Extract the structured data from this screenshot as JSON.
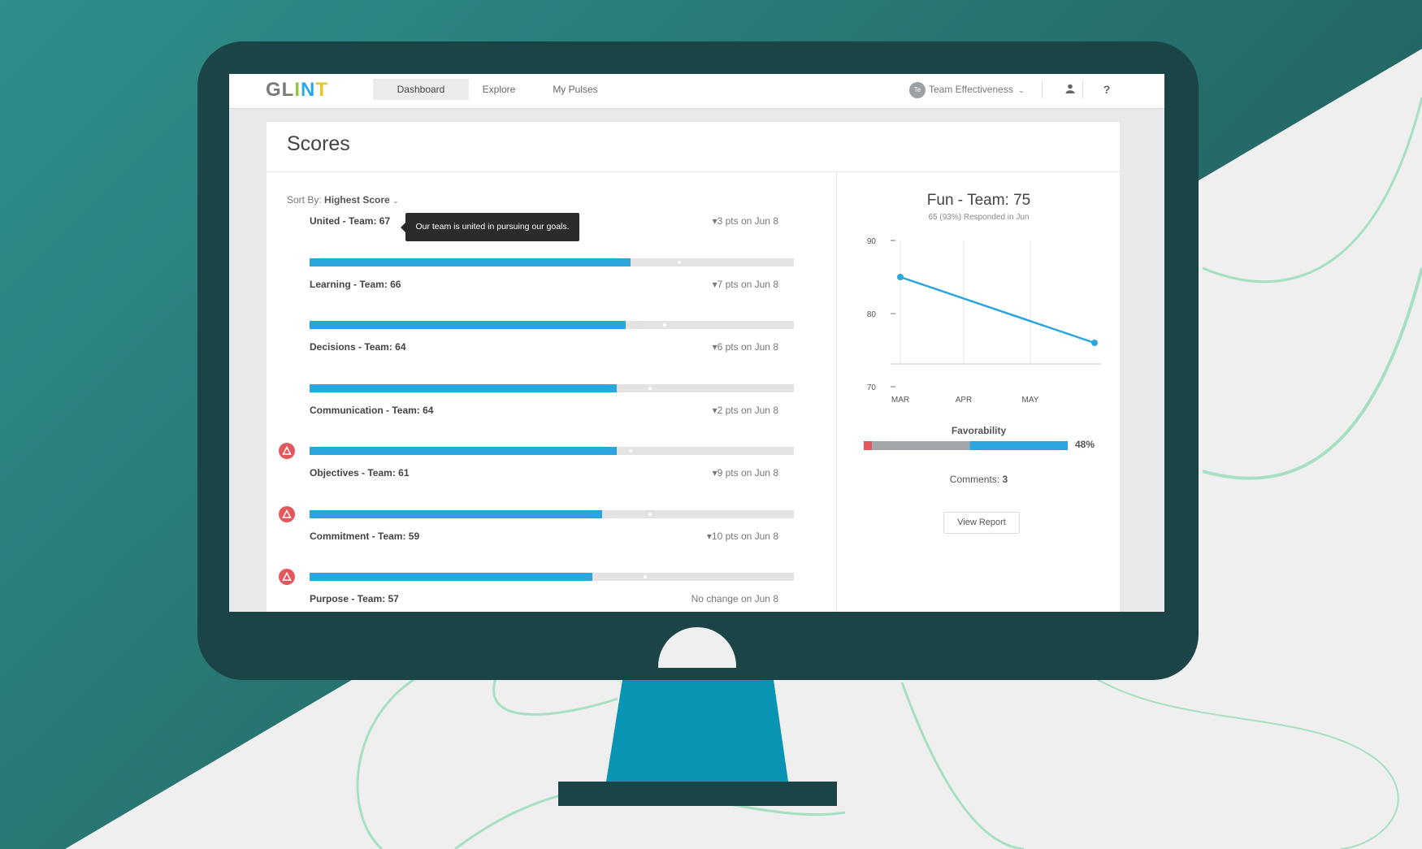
{
  "colors": {
    "bg_teal": "#2e8a86",
    "monitor": "#1b4447",
    "stand": "#0a94b4",
    "accent_blue": "#2aa6dd",
    "alert_red": "#e4585d"
  },
  "app": {
    "logo": [
      "GL",
      "I",
      "N",
      "T"
    ],
    "nav": [
      {
        "label": "Dashboard",
        "active": true
      },
      {
        "label": "Explore"
      },
      {
        "label": "My Pulses"
      }
    ],
    "team_badge": "Te",
    "team_selector": "Team Effectiveness",
    "user_icon": "user-icon",
    "help_label": "?"
  },
  "scores": {
    "title": "Scores",
    "sort_prefix": "Sort By:",
    "sort_value": "Highest Score",
    "tooltip": "Our team is united in pursuing our goals.",
    "rows": [
      {
        "label": "United - Team: 67",
        "change": "▾3 pts on Jun 8",
        "value": 67,
        "marker": 76
      },
      {
        "label": "Learning - Team: 66",
        "change": "▾7 pts on Jun 8",
        "value": 66,
        "marker": 73
      },
      {
        "label": "Decisions - Team: 64",
        "change": "▾6 pts on Jun 8",
        "value": 64,
        "marker": 70
      },
      {
        "label": "Communication - Team: 64",
        "change": "▾2 pts on Jun 8",
        "value": 64,
        "marker": 66
      },
      {
        "label": "Objectives - Team: 61",
        "change": "▾9 pts on Jun 8",
        "value": 61,
        "marker": 70,
        "alert": true
      },
      {
        "label": "Commitment - Team: 59",
        "change": "▾10 pts on Jun 8",
        "value": 59,
        "marker": 69,
        "alert": true
      },
      {
        "label": "Purpose - Team: 57",
        "change": "No change on Jun 8",
        "value": 57,
        "marker": 67,
        "alert": true
      }
    ]
  },
  "detail": {
    "title": "Fun - Team: 75",
    "subtitle": "65 (93%) Responded in Jun",
    "favorability_label": "Favorability",
    "favorability": {
      "unfavorable": 4,
      "neutral": 48,
      "favorable": 48
    },
    "favorability_pct": "48%",
    "comments_label": "Comments:",
    "comments_count": "3",
    "view_report": "View Report"
  },
  "chart_data": {
    "type": "line",
    "title": "Fun - Team: 75",
    "x": [
      "MAR",
      "APR",
      "MAY"
    ],
    "y_ticks": [
      "90",
      "80",
      "70"
    ],
    "ylim": [
      70,
      90
    ],
    "series": [
      {
        "points": [
          {
            "x": "MAR",
            "y": 85
          },
          {
            "x": "end",
            "y": 76
          }
        ]
      }
    ]
  }
}
